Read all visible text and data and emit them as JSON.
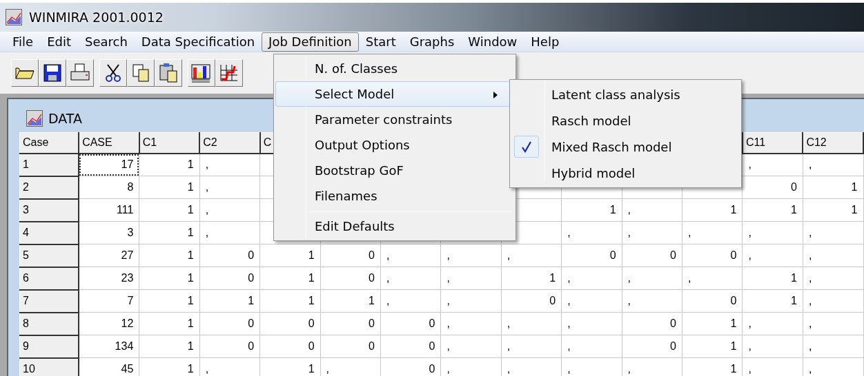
{
  "window": {
    "title": "WINMIRA 2001.0012"
  },
  "menu_bar": [
    {
      "label": "File",
      "selected": false
    },
    {
      "label": "Edit",
      "selected": false
    },
    {
      "label": "Search",
      "selected": false
    },
    {
      "label": "Data Specification",
      "selected": false
    },
    {
      "label": "Job Definition",
      "selected": true
    },
    {
      "label": "Start",
      "selected": false
    },
    {
      "label": "Graphs",
      "selected": false
    },
    {
      "label": "Window",
      "selected": false
    },
    {
      "label": "Help",
      "selected": false
    }
  ],
  "dropdown": [
    {
      "label": "N. of. Classes",
      "selected": false,
      "has_submenu": false,
      "separator_before": false
    },
    {
      "label": "Select Model",
      "selected": true,
      "has_submenu": true,
      "separator_before": false
    },
    {
      "label": "Parameter constraints",
      "selected": false,
      "has_submenu": false,
      "separator_before": false
    },
    {
      "label": "Output Options",
      "selected": false,
      "has_submenu": false,
      "separator_before": false
    },
    {
      "label": "Bootstrap GoF",
      "selected": false,
      "has_submenu": false,
      "separator_before": false
    },
    {
      "label": "Filenames",
      "selected": false,
      "has_submenu": false,
      "separator_before": false
    },
    {
      "label": "Edit Defaults",
      "selected": false,
      "has_submenu": false,
      "separator_before": true
    }
  ],
  "submenu": [
    {
      "label": "Latent class analysis",
      "checked": false
    },
    {
      "label": "Rasch model",
      "checked": false
    },
    {
      "label": "Mixed Rasch model",
      "checked": true
    },
    {
      "label": "Hybrid model",
      "checked": false
    }
  ],
  "data_window": {
    "title": "DATA",
    "columns": [
      "Case",
      "CASE",
      "C1",
      "C2",
      "C",
      null,
      null,
      null,
      null,
      null,
      null,
      null,
      "C11",
      "C12"
    ],
    "rows": [
      {
        "cells": [
          "1",
          "17",
          "1",
          ",",
          null,
          null,
          null,
          null,
          null,
          null,
          null,
          null,
          ",",
          ","
        ],
        "focused": true
      },
      {
        "cells": [
          "2",
          "8",
          "1",
          ",",
          null,
          null,
          null,
          null,
          null,
          null,
          null,
          null,
          "0",
          "1"
        ],
        "focused": false
      },
      {
        "cells": [
          "3",
          "111",
          "1",
          ",",
          null,
          null,
          null,
          null,
          null,
          "1",
          ",",
          "1",
          "1",
          "1"
        ],
        "focused": false
      },
      {
        "cells": [
          "4",
          "3",
          "1",
          ",",
          null,
          null,
          null,
          null,
          null,
          ",",
          ",",
          ",",
          ",",
          ","
        ],
        "focused": false
      },
      {
        "cells": [
          "5",
          "27",
          "1",
          "0",
          "1",
          "0",
          ",",
          ",",
          ",",
          "0",
          "0",
          "0",
          ",",
          ","
        ],
        "focused": false
      },
      {
        "cells": [
          "6",
          "23",
          "1",
          "0",
          "1",
          "0",
          ",",
          ",",
          "1",
          ",",
          ",",
          ",",
          "1",
          ","
        ],
        "focused": false
      },
      {
        "cells": [
          "7",
          "7",
          "1",
          "1",
          "1",
          "1",
          ",",
          ",",
          "0",
          ",",
          ",",
          "0",
          "1",
          ","
        ],
        "focused": false
      },
      {
        "cells": [
          "8",
          "12",
          "1",
          "0",
          "0",
          "0",
          "0",
          ",",
          ",",
          ",",
          "0",
          "1",
          ",",
          ","
        ],
        "focused": false
      },
      {
        "cells": [
          "9",
          "134",
          "1",
          "0",
          "0",
          "0",
          "0",
          ",",
          ",",
          ",",
          "0",
          "1",
          ",",
          ","
        ],
        "focused": false
      },
      {
        "cells": [
          "10",
          "45",
          "1",
          ",",
          "1",
          ",",
          "0",
          ",",
          ",",
          ",",
          ",",
          "1",
          ",",
          ","
        ],
        "focused": false
      }
    ]
  }
}
